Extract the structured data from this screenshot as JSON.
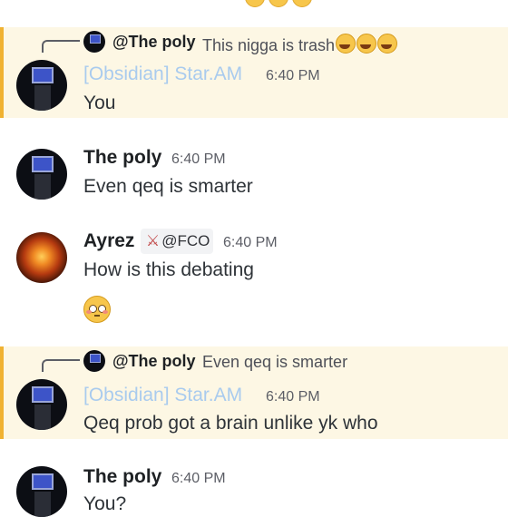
{
  "messages": [
    {
      "reply": {
        "name": "@The poly",
        "text": "This nigga is trash",
        "emoji": "😭😭😭"
      },
      "author": "[Obsidian] Star.AM",
      "time": "6:40 PM",
      "text": "You",
      "mention": true
    },
    {
      "author": "The poly",
      "time": "6:40 PM",
      "text": "Even qeq is smarter"
    },
    {
      "author": "Ayrez",
      "badge": "@FCO",
      "time": "6:40 PM",
      "text": "How is this debating",
      "extra_emoji": "😳"
    },
    {
      "reply": {
        "name": "@The poly",
        "text": "Even qeq is smarter"
      },
      "author": "[Obsidian] Star.AM",
      "time": "6:40 PM",
      "text": "Qeq prob got a brain unlike yk who",
      "mention": true
    },
    {
      "author": "The poly",
      "time": "6:40 PM",
      "text": "You?"
    }
  ],
  "colors": {
    "mention_bg": "#fdf7e4",
    "mention_bar": "#f0b232",
    "role_name": "#a9cbee"
  }
}
